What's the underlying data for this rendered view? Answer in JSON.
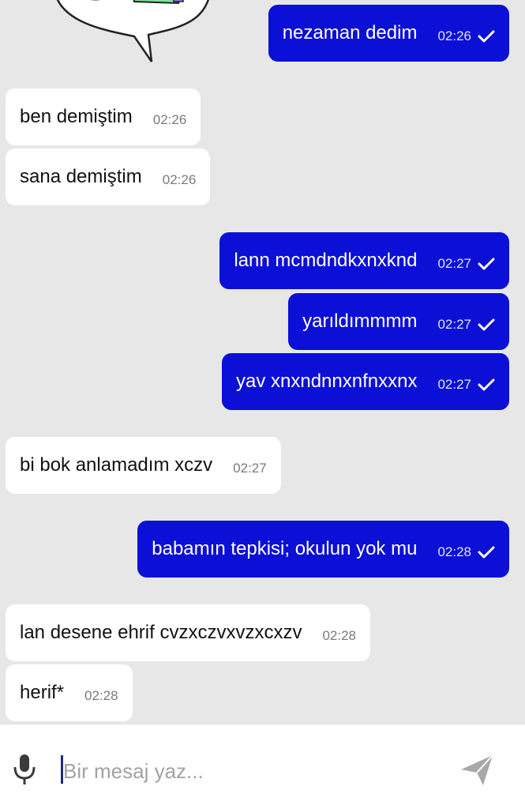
{
  "messages": [
    {
      "direction": "out",
      "text": "nezaman dedim",
      "time": "02:26",
      "status": "sent-check-icon"
    },
    {
      "direction": "in",
      "text": "ben demiştim",
      "time": "02:26"
    },
    {
      "direction": "in",
      "text": "sana demiştim",
      "time": "02:26"
    },
    {
      "direction": "out",
      "text": "lann mcmdndkxnxknd",
      "time": "02:27",
      "status": "sent-check-icon"
    },
    {
      "direction": "out",
      "text": "yarıldımmmm",
      "time": "02:27",
      "status": "sent-check-icon"
    },
    {
      "direction": "out",
      "text": "yav xnxndnnxnfnxxnx",
      "time": "02:27",
      "status": "sent-check-icon"
    },
    {
      "direction": "in",
      "text": "bi bok anlamadım xczv",
      "time": "02:27"
    },
    {
      "direction": "out",
      "text": "babamın tepkisi; okulun yok mu",
      "time": "02:28",
      "status": "sent-check-icon"
    },
    {
      "direction": "in",
      "text": "lan desene ehrif cvzxczvxvzxcxzv",
      "time": "02:28"
    },
    {
      "direction": "in",
      "text": "herif*",
      "time": "02:28"
    }
  ],
  "composer": {
    "placeholder": "Bir mesaj yaz...",
    "value": "",
    "mic_icon": "microphone-icon",
    "send_icon": "send-icon"
  },
  "colors": {
    "outgoing_bubble": "#0c10d6",
    "incoming_bubble": "#ffffff",
    "background": "#e7e7e8"
  }
}
